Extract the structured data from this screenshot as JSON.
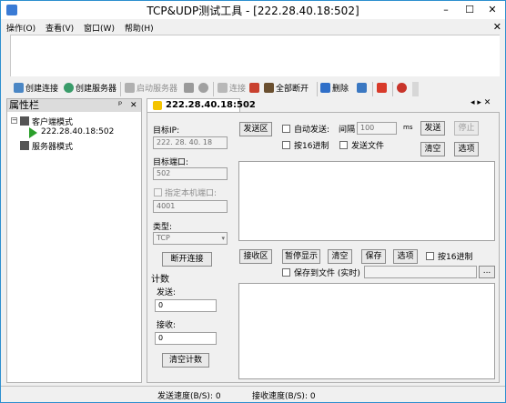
{
  "window": {
    "title": "TCP&UDP测试工具 - [222.28.40.18:502]",
    "minimize": "–",
    "maximize": "☐",
    "close": "✕"
  },
  "menu": {
    "items": [
      "操作(O)",
      "查看(V)",
      "窗口(W)",
      "帮助(H)"
    ],
    "close": "✕"
  },
  "toolbar": {
    "create_connection": "创建连接",
    "create_server": "创建服务器",
    "start_server": "启动服务器",
    "connect": "连接",
    "disconnect_all": "全部断开",
    "delete": "删除"
  },
  "sidebar": {
    "title": "属性栏",
    "pin": "ᵖ",
    "close": "✕",
    "client_mode": "客户端模式",
    "client_entry": "222.28.40.18:502",
    "server_mode": "服务器模式"
  },
  "tab": {
    "label": "222.28.40.18:502",
    "nav": "◂ ▸ ✕"
  },
  "settings": {
    "target_ip_label": "目标IP:",
    "target_ip": "222. 28. 40. 18",
    "target_port_label": "目标端口:",
    "target_port": "502",
    "local_port_label": "指定本机端口:",
    "local_port": "4001",
    "type_label": "类型:",
    "type_value": "TCP",
    "disconnect_button": "断开连接"
  },
  "counter": {
    "title": "计数",
    "send_label": "发送:",
    "send_value": "0",
    "recv_label": "接收:",
    "recv_value": "0",
    "clear_button": "清空计数"
  },
  "send_area": {
    "label": "发送区",
    "auto_send": "自动发送:",
    "interval": "间隔",
    "interval_value": "100",
    "interval_unit": "ms",
    "hex": "按16进制",
    "send_file": "发送文件",
    "send_button": "发送",
    "stop_button": "停止",
    "clear_button": "清空",
    "options_button": "选项"
  },
  "recv_area": {
    "label": "接收区",
    "pause": "暂停显示",
    "clear": "清空",
    "save": "保存",
    "options": "选项",
    "hex": "按16进制",
    "save_to_file": "保存到文件 (实时)",
    "browse": "..."
  },
  "status": {
    "send_speed": "发送速度(B/S): 0",
    "recv_speed": "接收速度(B/S): 0"
  },
  "colors": {
    "window_border": "#2d8fcf",
    "tab_icon": "#f4c400",
    "tree_arrow": "#2a9f2a"
  }
}
